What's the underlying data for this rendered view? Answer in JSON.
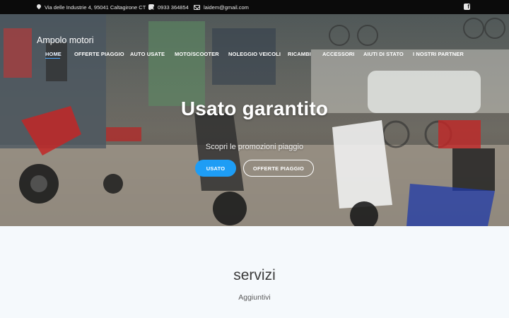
{
  "topbar": {
    "address": "Via delle Industrie 4, 95041 Caltagirone CT",
    "phone": "0933 364854",
    "email": "laidem@gmail.com",
    "social_icon": "facebook-icon"
  },
  "header": {
    "brand": "Ampolo motori",
    "nav": [
      {
        "label": "HOME",
        "active": true
      },
      {
        "label": "OFFERTE PIAGGIO"
      },
      {
        "label": "AUTO USATE"
      },
      {
        "label": "MOTO/SCOOTER"
      },
      {
        "label": "NOLEGGIO VEICOLI"
      },
      {
        "label": "RICAMBI"
      },
      {
        "label": "ACCESSORI"
      },
      {
        "label": "AIUTI DI STATO"
      },
      {
        "label": "I NOSTRI PARTNER"
      }
    ]
  },
  "hero": {
    "title": "Usato garantito",
    "subtitle": "Scopri le promozioni piaggio",
    "primary_button": "USATO",
    "secondary_button": "OFFERTE PIAGGIO"
  },
  "services": {
    "title": "servizi",
    "subtitle": "Aggiuntivi"
  },
  "colors": {
    "accent": "#1e9df5",
    "topbar_bg": "#0b0b0b",
    "section_bg": "#f5f9fc"
  }
}
